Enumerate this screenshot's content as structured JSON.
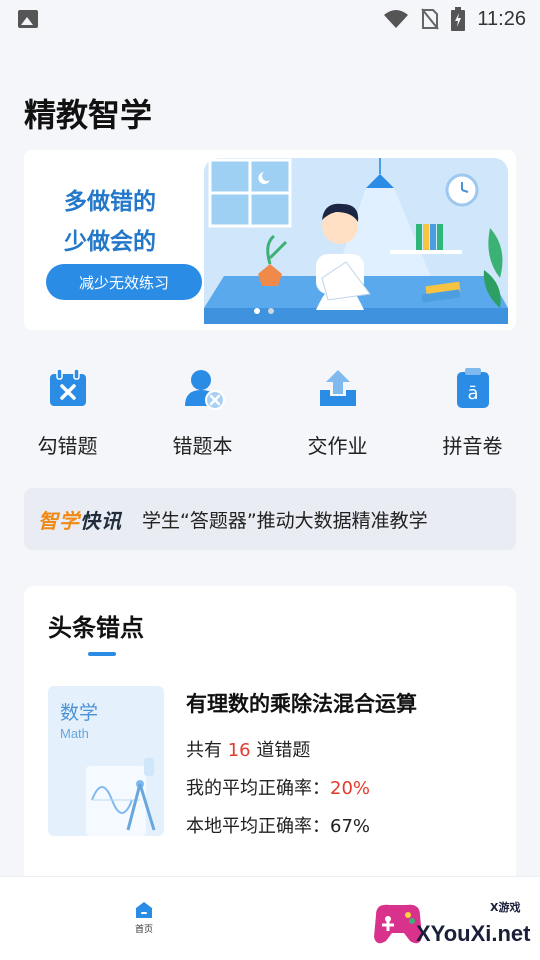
{
  "status_bar": {
    "time": "11:26"
  },
  "app": {
    "title": "精教智学"
  },
  "banner": {
    "line1": "多做错的",
    "line2": "少做会的",
    "button_label": "减少无效练习"
  },
  "actions": [
    {
      "label": "勾错题",
      "icon": "check-wrong-icon"
    },
    {
      "label": "错题本",
      "icon": "wrong-book-icon"
    },
    {
      "label": "交作业",
      "icon": "upload-homework-icon"
    },
    {
      "label": "拼音卷",
      "icon": "pinyin-paper-icon"
    }
  ],
  "news": {
    "tag_part1": "智学",
    "tag_part2": "快讯",
    "text": "学生“答题器”推动大数据精准教学"
  },
  "top_errors": {
    "title": "头条错点",
    "item": {
      "subject": "数学",
      "subject_en": "Math",
      "topic": "有理数的乘除法混合运算",
      "count_prefix": "共有 ",
      "count": "16",
      "count_suffix": " 道错题",
      "my_rate_label": "我的平均正确率：",
      "my_rate": "20%",
      "local_rate_label": "本地平均正确率：",
      "local_rate": "67%"
    }
  },
  "bottom_nav": {
    "home_label": "首页"
  },
  "watermark": {
    "brand": "XYouXi.net",
    "small": "X游戏"
  },
  "colors": {
    "accent": "#2b8ce6",
    "highlight": "#e23b2c",
    "news_tag": "#f08a17"
  }
}
